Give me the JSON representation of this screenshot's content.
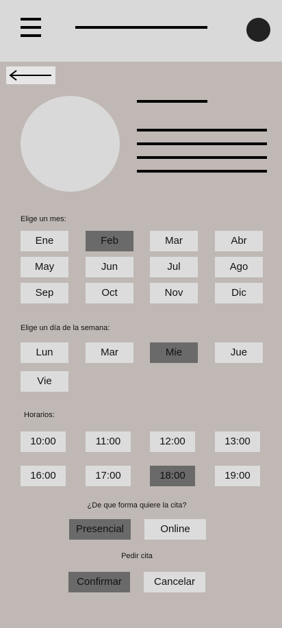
{
  "icons": {
    "menu": "hamburger-menu-icon",
    "avatar": "user-avatar-icon",
    "back": "back-arrow-icon"
  },
  "months": {
    "label": "Elige un mes:",
    "items": [
      {
        "label": "Ene",
        "selected": false
      },
      {
        "label": "Feb",
        "selected": true
      },
      {
        "label": "Mar",
        "selected": false
      },
      {
        "label": "Abr",
        "selected": false
      },
      {
        "label": "May",
        "selected": false
      },
      {
        "label": "Jun",
        "selected": false
      },
      {
        "label": "Jul",
        "selected": false
      },
      {
        "label": "Ago",
        "selected": false
      },
      {
        "label": "Sep",
        "selected": false
      },
      {
        "label": "Oct",
        "selected": false
      },
      {
        "label": "Nov",
        "selected": false
      },
      {
        "label": "Dic",
        "selected": false
      }
    ]
  },
  "weekdays": {
    "label": "Elige un día de la semana:",
    "items": [
      {
        "label": "Lun",
        "selected": false
      },
      {
        "label": "Mar",
        "selected": false
      },
      {
        "label": "Mie",
        "selected": true
      },
      {
        "label": "Jue",
        "selected": false
      },
      {
        "label": "Vie",
        "selected": false
      }
    ]
  },
  "schedule": {
    "label": "Horarios:",
    "items": [
      {
        "label": "10:00",
        "selected": false
      },
      {
        "label": "11:00",
        "selected": false
      },
      {
        "label": "12:00",
        "selected": false
      },
      {
        "label": "13:00",
        "selected": false
      },
      {
        "label": "16:00",
        "selected": false
      },
      {
        "label": "17:00",
        "selected": false
      },
      {
        "label": "18:00",
        "selected": true
      },
      {
        "label": "19:00",
        "selected": false
      }
    ]
  },
  "mode": {
    "question": "¿De que forma quiere la cita?",
    "presencial": "Presencial",
    "online": "Online",
    "selected": "Presencial"
  },
  "request": {
    "label": "Pedir cita",
    "confirm": "Confirmar",
    "cancel": "Cancelar"
  },
  "colors": {
    "background": "#c0b8b5",
    "header": "#d9d9d9",
    "chip": "#dcdcdc",
    "chip_selected": "#6a6a6a"
  }
}
